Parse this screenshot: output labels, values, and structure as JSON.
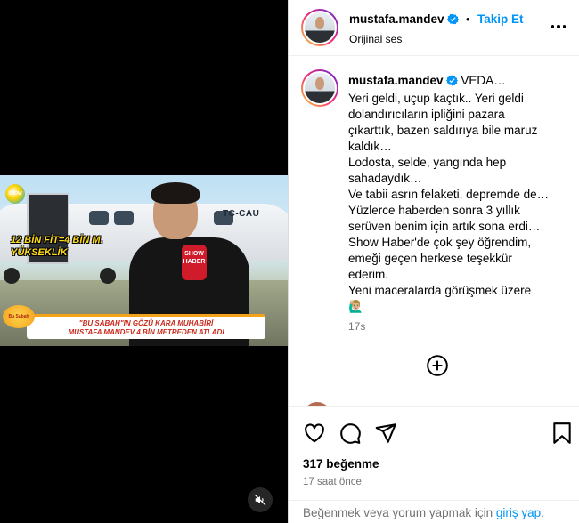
{
  "post": {
    "author": {
      "username": "mustafa.mandev",
      "verified": true,
      "follow_label": "Takip Et",
      "separator": "•",
      "audio_label": "Orijinal ses"
    },
    "video": {
      "channel_logo": "SHOW",
      "overlay_caption": [
        "12 BİN FİT=4 BİN M.",
        "YÜKSEKLİK"
      ],
      "aircraft_registration": "TC-CAU",
      "microphone_label": "SHOW HABER",
      "program_badge": "Bu Sabah",
      "lower_third": [
        "\"BU SABAH\"IN GÖZÜ KARA MUHABİRİ",
        "MUSTAFA MANDEV 4 BİN METREDEN ATLADI"
      ],
      "muted": true
    },
    "caption": {
      "username": "mustafa.mandev",
      "lines": [
        "VEDA…",
        "Yeri geldi, uçup kaçtık.. Yeri geldi",
        "dolandırıcıların ipliğini pazara",
        "çıkarttık, bazen saldırıya bile maruz",
        "kaldık…",
        "Lodosta, selde, yangında hep",
        "sahadaydık…",
        "Ve tabii asrın felaketi, depremde de…",
        "Yüzlerce haberden sonra 3 yıllık",
        "serüven benim için artık sona erdi…",
        "Show Haber'de çok şey öğrendim,",
        "emeği geçen herkese teşekkür",
        "ederim.",
        "Yeni maceralarda görüşmek üzere"
      ],
      "emoji": "🙋🏼‍♂️",
      "relative_time": "17s"
    },
    "likes": "317 beğenme",
    "posted": "17 saat önce",
    "login_prompt": {
      "text": "Beğenmek veya yorum yapmak için",
      "link": "giriş yap",
      "suffix": "."
    }
  },
  "icons": {
    "more": "more-options-icon",
    "load_more": "plus-circle-icon",
    "like": "heart-icon",
    "comment": "comment-icon",
    "share": "share-icon",
    "save": "bookmark-icon",
    "mute": "speaker-muted-icon",
    "verified": "verified-badge-icon"
  },
  "colors": {
    "accent": "#0095f6",
    "muted_text": "#737373",
    "divider": "#dbdbdb"
  }
}
